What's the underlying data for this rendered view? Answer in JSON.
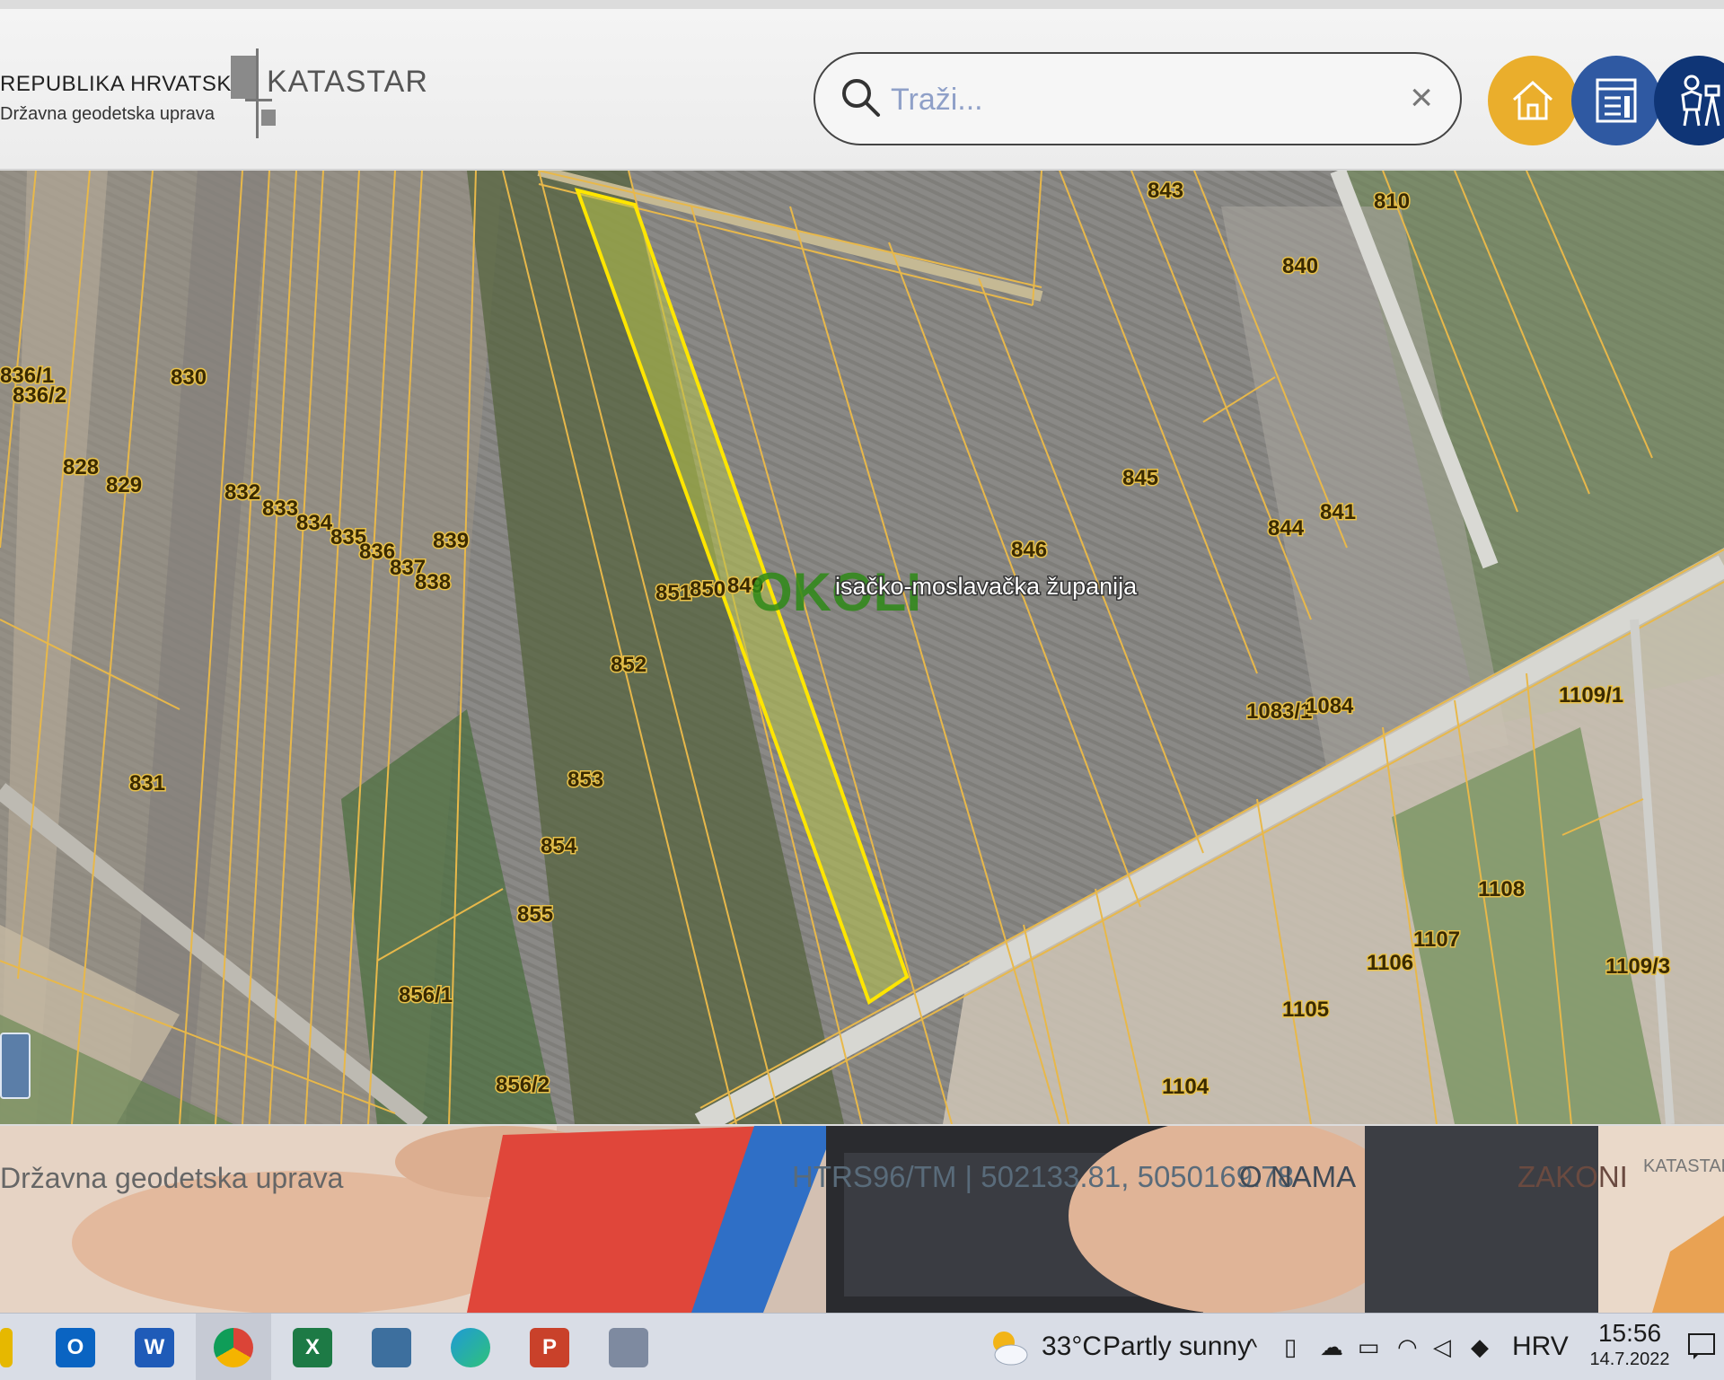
{
  "header": {
    "org_line1": "REPUBLIKA HRVATSKA",
    "org_line2": "Državna geodetska uprava",
    "app_logo": "KATASTAR",
    "search": {
      "placeholder": "Traži...",
      "value": "",
      "clear_icon": "×"
    },
    "buttons": [
      {
        "icon": "home-icon",
        "color": "#eaae2c"
      },
      {
        "icon": "list-icon",
        "color": "#2f59a2"
      },
      {
        "icon": "surveyor-icon",
        "color": "#0f3576"
      }
    ]
  },
  "map": {
    "selected_parcel_outline": "#ffe600",
    "parcel_line_color": "#e8b84a",
    "region_label": "OKOLI",
    "county_label": "isačko-moslavačka županija",
    "parcels": [
      "843",
      "840",
      "810",
      "836/1",
      "836/2",
      "830",
      "828",
      "829",
      "832",
      "833",
      "834",
      "835",
      "836",
      "837",
      "838",
      "839",
      "845",
      "846",
      "841",
      "844",
      "851",
      "850",
      "849",
      "852",
      "853",
      "854",
      "855",
      "856/1",
      "856/2",
      "831",
      "1109/1",
      "1108",
      "1107",
      "1106",
      "1105",
      "1104",
      "1109/3",
      "1083/1",
      "1084"
    ]
  },
  "footer": {
    "left_text": "Državna geodetska uprava",
    "coordinates": "HTRS96/TM | 502133.81, 5050169.78",
    "about": "O NAMA",
    "laws": "ZAKONI",
    "logo": "KATASTAR"
  },
  "taskbar": {
    "weather_temp": "33°C",
    "weather_text": "Partly sunny",
    "language": "HRV",
    "time": "15:56",
    "date": "14.7.2022"
  }
}
